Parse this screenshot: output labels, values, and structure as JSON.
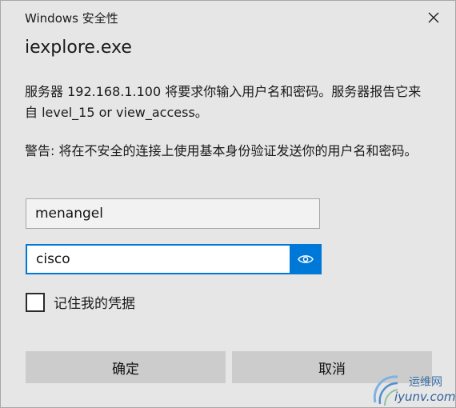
{
  "window": {
    "title": "Windows 安全性"
  },
  "app_name": "iexplore.exe",
  "message": "服务器 192.168.1.100 将要求你输入用户名和密码。服务器报告它来自 level_15 or view_access。",
  "warning": "警告: 将在不安全的连接上使用基本身份验证发送你的用户名和密码。",
  "username_field": {
    "value": "menangel"
  },
  "password_field": {
    "value": "cisco",
    "reveal_icon": "eye-icon"
  },
  "remember": {
    "label": "记住我的凭据",
    "checked": false
  },
  "buttons": {
    "ok": "确定",
    "cancel": "取消"
  },
  "watermark": {
    "line1": "运维网",
    "line2": "iyunv.com"
  },
  "colors": {
    "accent": "#0078d7",
    "dialog_bg": "#e6e6e6",
    "button_bg": "#cccccc"
  }
}
